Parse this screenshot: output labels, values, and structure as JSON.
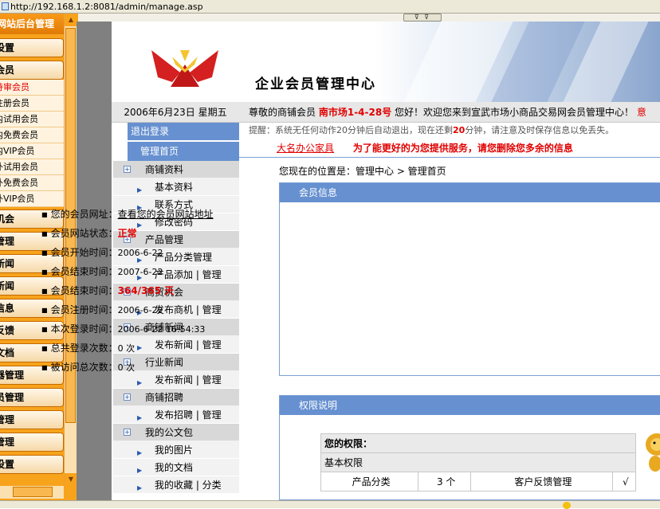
{
  "browser": {
    "url": "http://192.168.1.2:8081/admin/manage.asp"
  },
  "left_frame": {
    "title": "网站后台管理",
    "buttons_top": [
      "设置",
      "会员"
    ],
    "member_links": [
      "待审会员",
      "注册会员",
      "内试用会员",
      "内免费会员",
      "内VIP会员",
      "外试用会员",
      "外免费会员",
      "外VIP会员"
    ],
    "buttons_bottom": [
      "机会",
      "管理",
      "新闻",
      "新闻",
      "信息",
      "反馈",
      "文档",
      "器管理",
      "员管理",
      "管理",
      "管理",
      "设置"
    ]
  },
  "header": {
    "title": "企业会员管理中心"
  },
  "date_bar": {
    "date": "2006年6月23日 星期五"
  },
  "welcome": {
    "prefix": "尊敬的商铺会员",
    "shop": "南市场1-4-28号",
    "suffix": "您好！欢迎您来到宣武市场小商品交易网会员管理中心！",
    "more": "意"
  },
  "tip": {
    "prefix": "提醒：系统无任何动作20分钟后自动退出，现在还剩",
    "minutes": "20",
    "suffix": "分钟，请注意及时保存信息以免丢失。"
  },
  "ad": {
    "link": "大名办公家具",
    "message": "为了能更好的为您提供服务，请您删除您多余的信息"
  },
  "nav": {
    "logout": "退出登录",
    "home": "管理首页",
    "sections": [
      {
        "title": "商铺资料",
        "items": [
          "基本资料",
          "联系方式",
          "修改密码"
        ]
      },
      {
        "title": "产品管理",
        "items": [
          "产品分类管理",
          "产品添加 | 管理"
        ]
      },
      {
        "title": "商贸机会",
        "items": [
          "发布商机 | 管理"
        ]
      },
      {
        "title": "商铺新闻",
        "items": [
          "发布新闻 | 管理"
        ]
      },
      {
        "title": "行业新闻",
        "items": [
          "发布新闻 | 管理"
        ]
      },
      {
        "title": "商铺招聘",
        "items": [
          "发布招聘 | 管理"
        ]
      },
      {
        "title": "我的公文包",
        "items": [
          "我的图片",
          "我的文档",
          "我的收藏 | 分类"
        ]
      }
    ]
  },
  "location": "您现在的位置是：管理中心 > 管理首页",
  "member_info": {
    "title": "会员信息",
    "rows": [
      {
        "label": "您的会员网址：",
        "value": "查看您的会员网站地址",
        "style": "link"
      },
      {
        "label": "会员网站状态：",
        "value": "正常",
        "style": "red"
      },
      {
        "label": "会员开始时间：",
        "value": "2006-6-22",
        "style": "normal"
      },
      {
        "label": "会员结束时间：",
        "value": "2007-6-22",
        "style": "normal"
      },
      {
        "label": "会员结束时间：",
        "value": "364/365 天",
        "style": "red"
      },
      {
        "label": "会员注册时间：",
        "value": "2006-6-22",
        "style": "normal"
      },
      {
        "label": "本次登录时间：",
        "value": "2006-6-22 16:54:33",
        "style": "normal"
      },
      {
        "label": "总共登录次数：",
        "value": "0 次",
        "style": "normal"
      },
      {
        "label": "被访问总次数：",
        "value": "0 次",
        "style": "normal"
      }
    ]
  },
  "rights": {
    "title": "权限说明",
    "your_rights": "您的权限：",
    "basic": "基本权限",
    "row": {
      "c1": "产品分类",
      "c2": "3 个",
      "c3": "客户反馈管理",
      "c4": "√"
    }
  },
  "colors": {
    "accent_blue": "#6690d0",
    "orange": "#f7a31c",
    "red": "#e00000"
  }
}
